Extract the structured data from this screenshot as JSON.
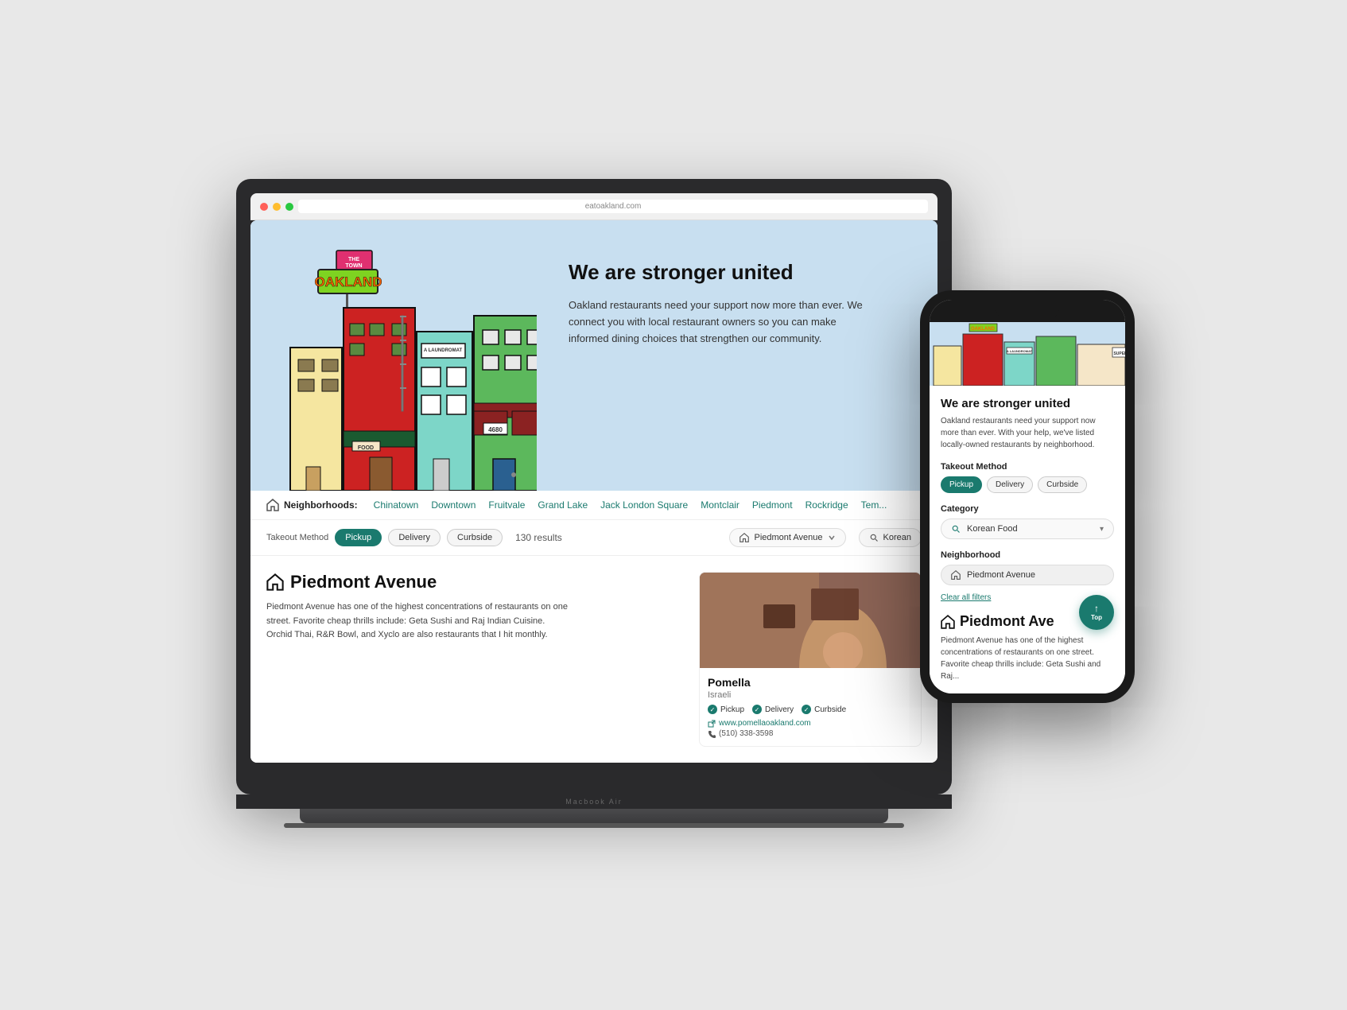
{
  "hero": {
    "title": "We are stronger united",
    "description": "Oakland restaurants need your support now more than ever. We connect you with local restaurant owners so you can make informed dining choices that strengthen our community."
  },
  "navbar": {
    "label": "Neighborhoods:",
    "links": [
      "Chinatown",
      "Downtown",
      "Fruitvale",
      "Grand Lake",
      "Jack London Square",
      "Montclair",
      "Piedmont",
      "Rockridge",
      "Tem..."
    ]
  },
  "filter": {
    "label": "Takeout Method",
    "pills": [
      "Pickup",
      "Delivery",
      "Curbside"
    ],
    "results": "130 results",
    "neighborhood_label": "Neighborhood",
    "neighborhood_value": "Piedmont Avenue",
    "category_label": "Category",
    "category_value": "Korean"
  },
  "neighborhood": {
    "title": "Piedmont Avenue",
    "description": "Piedmont Avenue has one of the highest concentrations of restaurants on one street. Favorite cheap thrills include: Geta Sushi and Raj Indian Cuisine. Orchid Thai, R&R Bowl, and Xyclo are also restaurants that I hit monthly."
  },
  "restaurant": {
    "name": "Pomella",
    "cuisine": "Israeli",
    "pickup": "Pickup",
    "delivery": "Delivery",
    "curbside": "Curbside",
    "website": "www.pomellaoakland.com",
    "phone": "(510) 338-3598"
  },
  "signs": {
    "the_town": "THE TOWN",
    "oakland": "OAKLAND",
    "laundromat": "A LAUNDROMAT",
    "supermarket": "SUPER MARKE..."
  },
  "phone": {
    "title": "We are stronger united",
    "description": "Oakland restaurants need your support now more than ever. With your help, we've listed locally-owned restaurants by neighborhood.",
    "takeout_label": "Takeout Method",
    "pills": [
      "Pickup",
      "Delivery",
      "Curbside"
    ],
    "category_label": "Category",
    "category_value": "Korean Food",
    "neighborhood_label": "Neighborhood",
    "neighborhood_value": "Piedmont Avenue",
    "clear_filters": "Clear all filters",
    "neighborhood_title": "Piedmont Ave",
    "neighborhood_desc": "Piedmont Avenue has one of the highest concentrations of restaurants on one street. Favorite cheap thrills include: Geta Sushi and Raj...",
    "top_button": "Top"
  },
  "browser_url": "eatoakland.com",
  "macbook_label": "Macbook Air"
}
